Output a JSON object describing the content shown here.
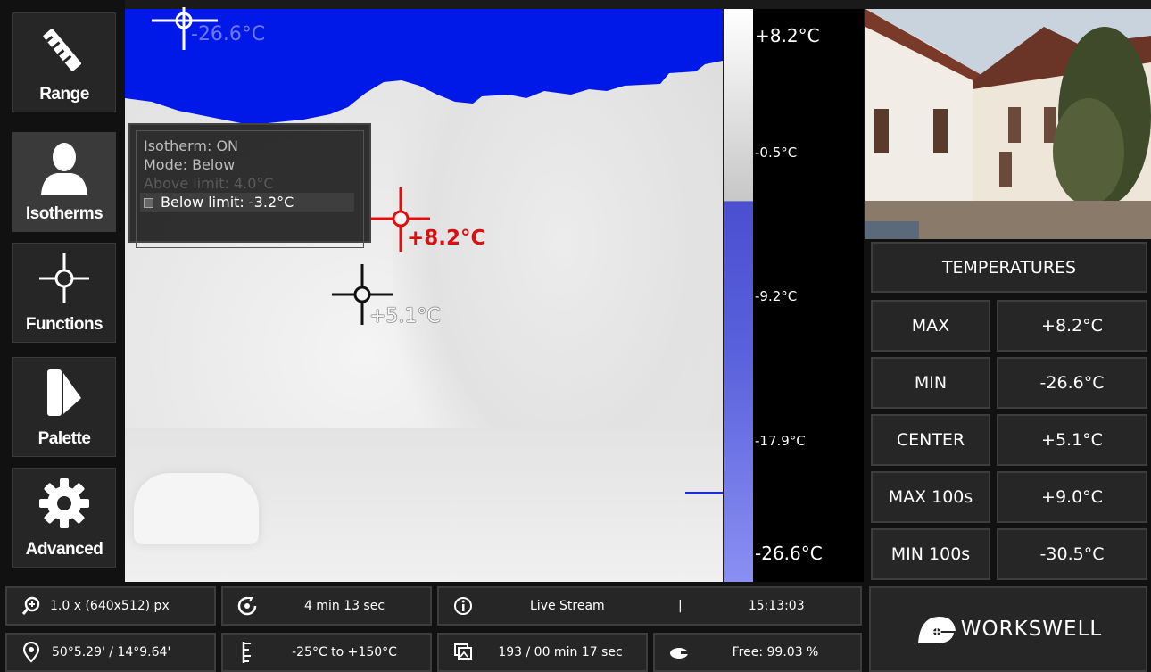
{
  "sidebar": {
    "items": [
      {
        "label": "Range",
        "icon": "ruler-icon"
      },
      {
        "label": "Isotherms",
        "icon": "person-icon"
      },
      {
        "label": "Functions",
        "icon": "crosshair-icon"
      },
      {
        "label": "Palette",
        "icon": "palette-icon"
      },
      {
        "label": "Advanced",
        "icon": "gear-icon"
      }
    ]
  },
  "isotherm_menu": {
    "status": "Isotherm: ON",
    "mode": "Mode: Below",
    "above_limit": "Above limit: 4.0°C",
    "below_limit": "Below limit: -3.2°C"
  },
  "markers": {
    "min_label": "-26.6°C",
    "max_label": "+8.2°C",
    "center_label": "+5.1°C"
  },
  "scale": {
    "top": "+8.2°C",
    "t1": "-0.5°C",
    "t2": "-9.2°C",
    "t3": "-17.9°C",
    "bottom": "-26.6°C"
  },
  "temperatures": {
    "title": "TEMPERATURES",
    "rows": [
      {
        "name": "MAX",
        "value": "+8.2°C"
      },
      {
        "name": "MIN",
        "value": "-26.6°C"
      },
      {
        "name": "CENTER",
        "value": "+5.1°C"
      },
      {
        "name": "MAX 100s",
        "value": "+9.0°C"
      },
      {
        "name": "MIN 100s",
        "value": "-30.5°C"
      }
    ]
  },
  "status": {
    "zoom": "1.0 x (640x512) px",
    "timer": "4 min 13 sec",
    "mode": "Live Stream",
    "separator": "|",
    "time": "15:13:03",
    "gps": "50°5.29' / 14°9.64'",
    "range": "-25°C to +150°C",
    "images": "193 / 00 min 17 sec",
    "storage": "Free: 99.03 %"
  },
  "brand": {
    "name": "WORKSWELL"
  },
  "colors": {
    "isotherm_blue": "#0018e8",
    "max_marker": "#e01010",
    "panel": "#262626",
    "border": "#3d3d3d"
  }
}
